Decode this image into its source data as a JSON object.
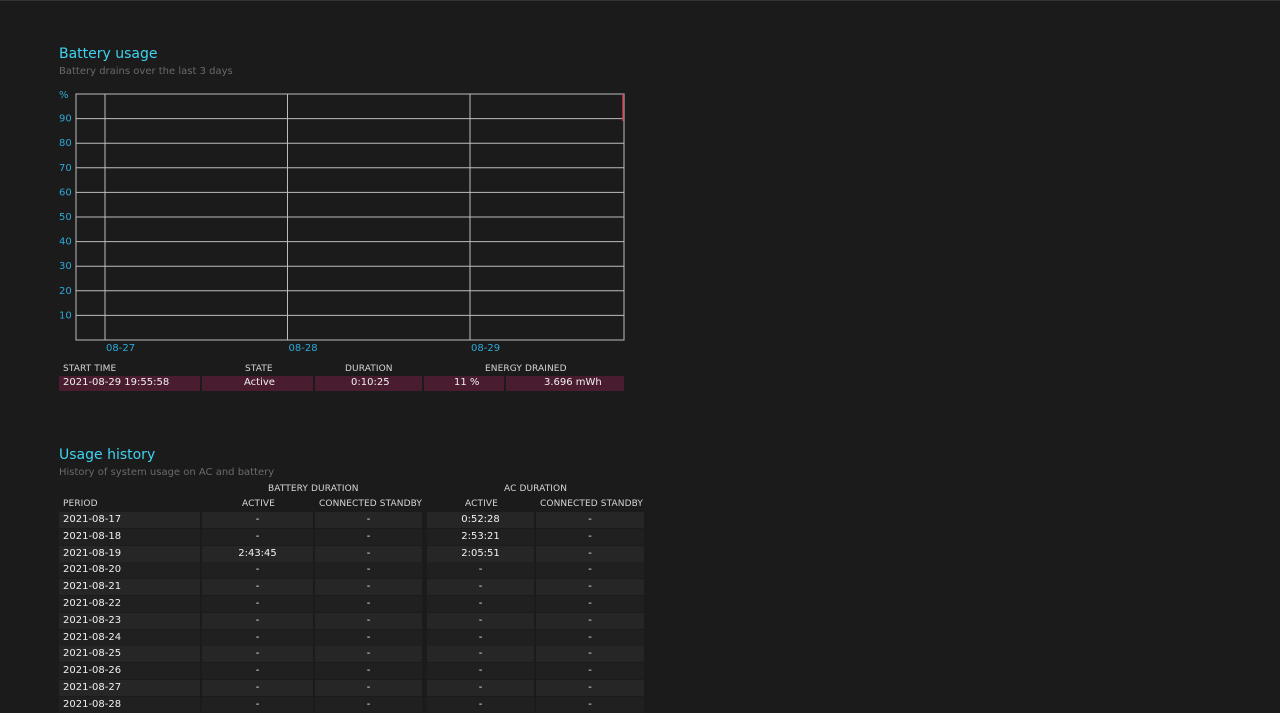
{
  "battery_usage": {
    "title": "Battery usage",
    "subtitle": "Battery drains over the last 3 days"
  },
  "chart_data": {
    "type": "line",
    "ylabel": "%",
    "ylim": [
      0,
      100
    ],
    "y_ticks": [
      "90",
      "80",
      "70",
      "60",
      "50",
      "40",
      "30",
      "20",
      "10"
    ],
    "x_ticks": [
      "08-27",
      "08-28",
      "08-29"
    ],
    "grid": true,
    "series": []
  },
  "drains_table": {
    "headers": [
      "START TIME",
      "STATE",
      "DURATION",
      "ENERGY DRAINED"
    ],
    "rows": [
      {
        "start": "2021-08-29  19:55:58",
        "state": "Active",
        "duration": "0:10:25",
        "percent": "11 %",
        "energy": "3.696 mWh"
      }
    ]
  },
  "usage_history": {
    "title": "Usage history",
    "subtitle": "History of system usage on AC and battery",
    "group_battery": "BATTERY DURATION",
    "group_ac": "AC DURATION",
    "headers": [
      "PERIOD",
      "ACTIVE",
      "CONNECTED STANDBY",
      "ACTIVE",
      "CONNECTED STANDBY"
    ],
    "rows": [
      [
        "2021-08-17",
        "-",
        "-",
        "0:52:28",
        "-"
      ],
      [
        "2021-08-18",
        "-",
        "-",
        "2:53:21",
        "-"
      ],
      [
        "2021-08-19",
        "2:43:45",
        "-",
        "2:05:51",
        "-"
      ],
      [
        "2021-08-20",
        "-",
        "-",
        "-",
        "-"
      ],
      [
        "2021-08-21",
        "-",
        "-",
        "-",
        "-"
      ],
      [
        "2021-08-22",
        "-",
        "-",
        "-",
        "-"
      ],
      [
        "2021-08-23",
        "-",
        "-",
        "-",
        "-"
      ],
      [
        "2021-08-24",
        "-",
        "-",
        "-",
        "-"
      ],
      [
        "2021-08-25",
        "-",
        "-",
        "-",
        "-"
      ],
      [
        "2021-08-26",
        "-",
        "-",
        "-",
        "-"
      ],
      [
        "2021-08-27",
        "-",
        "-",
        "-",
        "-"
      ],
      [
        "2021-08-28",
        "-",
        "-",
        "-",
        "-"
      ]
    ]
  },
  "colors": {
    "title": "#3ed3f0",
    "axis_label": "#2ea8d8",
    "grid": "#bdbdbd",
    "drain_row": "#4a1c30",
    "drain_marker": "#c0394a"
  }
}
